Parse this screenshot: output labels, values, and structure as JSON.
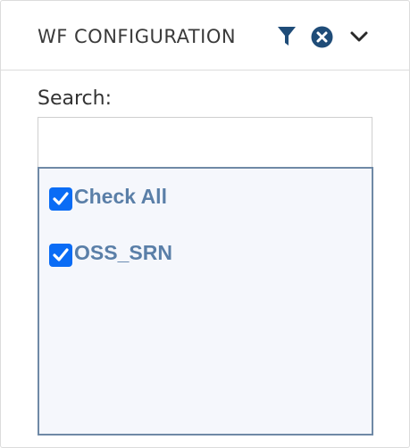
{
  "panel": {
    "title": "WF CONFIGURATION",
    "icons": {
      "filter": "filter-icon",
      "clear": "clear-icon",
      "collapse": "chevron-down-icon"
    }
  },
  "search": {
    "label": "Search:",
    "value": "",
    "placeholder": ""
  },
  "options": [
    {
      "label": "Check All",
      "checked": true
    },
    {
      "label": "OSS_SRN",
      "checked": true
    }
  ],
  "colors": {
    "accent": "#0a6cf5",
    "icon": "#1f4c78",
    "option_text": "#5a7fa8",
    "list_border": "#6f89a6",
    "list_background": "#f5f7fc"
  }
}
